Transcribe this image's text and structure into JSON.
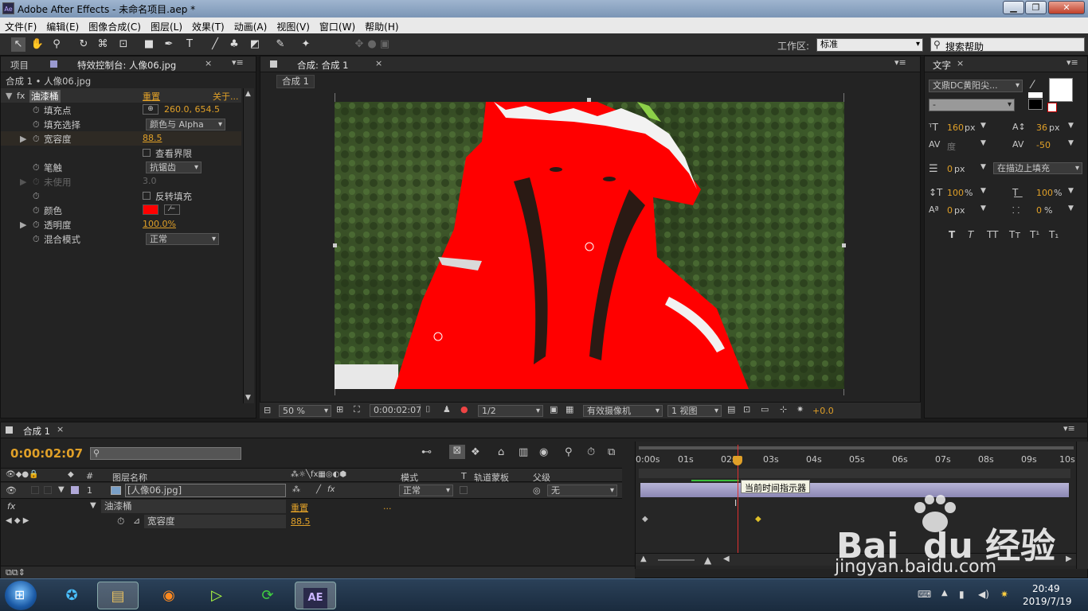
{
  "window": {
    "title": "Adobe After Effects - 未命名项目.aep *",
    "logo": "Ae",
    "minimize": "▁",
    "maximize": "❐",
    "close": "✕"
  },
  "menu": [
    "文件(F)",
    "编辑(E)",
    "图像合成(C)",
    "图层(L)",
    "效果(T)",
    "动画(A)",
    "视图(V)",
    "窗口(W)",
    "帮助(H)"
  ],
  "toolbar": {
    "workspace_label": "工作区:",
    "workspace_value": "标准",
    "search_placeholder": "搜索帮助"
  },
  "left_panel": {
    "tab_project": "项目",
    "tab_effects": "特效控制台: 人像06.jpg",
    "breadcrumb": "合成 1 • 人像06.jpg",
    "effect_name": "油漆桶",
    "reset": "重置",
    "about": "关于...",
    "props": [
      {
        "label": "填充点",
        "value": "260.0, 654.5"
      },
      {
        "label": "填充选择",
        "value": "颜色与 Alpha"
      },
      {
        "label": "宽容度",
        "value": "88.5"
      },
      {
        "label": "",
        "value": "查看界限"
      },
      {
        "label": "笔触",
        "value": "抗锯齿"
      },
      {
        "label": "未使用",
        "value": "3.0"
      },
      {
        "label": "",
        "value": "反转填充"
      },
      {
        "label": "颜色",
        "value": ""
      },
      {
        "label": "透明度",
        "value": "100.0%"
      },
      {
        "label": "混合模式",
        "value": "正常"
      }
    ],
    "fill_color": "#ff0000"
  },
  "comp_panel": {
    "tab": "合成: 合成 1",
    "subtab": "合成 1",
    "zoom": "50 %",
    "timecode": "0:00:02:07",
    "resolution": "1/2",
    "camera": "有效摄像机",
    "views": "1 视图",
    "exposure": "+0.0"
  },
  "char_panel": {
    "tab": "文字",
    "font": "文鼎DC黄阳尖...",
    "style": "-",
    "font_size": "160",
    "font_size_unit": "px",
    "leading": "36",
    "leading_unit": "px",
    "kerning": "度",
    "tracking": "-50",
    "stroke": "0",
    "stroke_unit": "px",
    "stroke_type": "在描边上填充",
    "vscale": "100",
    "hscale": "100",
    "percent": "%",
    "baseline": "0",
    "baseline_unit": "px",
    "tsume": "0",
    "style_buttons": [
      "T",
      "T",
      "TT",
      "Tт",
      "T¹",
      "T₁"
    ]
  },
  "timeline": {
    "tab": "合成 1",
    "timecode": "0:00:02:07",
    "col_hash": "#",
    "col_layer_name": "图层名称",
    "col_mode": "模式",
    "col_t": "T",
    "col_trkmat": "轨道蒙板",
    "col_parent": "父级",
    "layer_num": "1",
    "layer_name": "[人像06.jpg]",
    "layer_mode": "正常",
    "layer_parent": "无",
    "effect_row": "油漆桶",
    "effect_reset": "重置",
    "effect_dots": "...",
    "prop_row": "宽容度",
    "prop_value": "88.5",
    "ruler": [
      "0:00s",
      "01s",
      "02s",
      "03s",
      "04s",
      "05s",
      "06s",
      "07s",
      "08s",
      "09s",
      "10s"
    ],
    "tooltip": "当前时间指示器"
  },
  "watermark": {
    "brand": "Bai  du 经验",
    "url": "jingyan.baidu.com"
  },
  "taskbar": {
    "time": "20:49",
    "date": "2019/7/19",
    "ae_label": "AE"
  }
}
